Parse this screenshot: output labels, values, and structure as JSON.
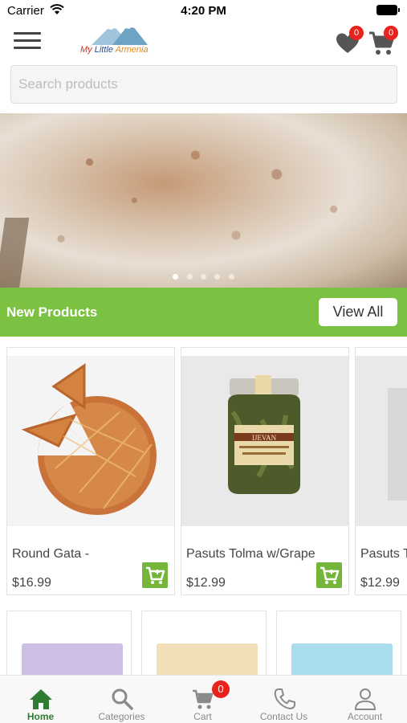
{
  "status_bar": {
    "carrier": "Carrier",
    "time": "4:20 PM"
  },
  "header": {
    "logo_words": [
      "My",
      "Little",
      "Armenia"
    ],
    "wishlist_count": "0",
    "cart_count": "0"
  },
  "search": {
    "placeholder": "Search products",
    "value": ""
  },
  "banner": {
    "slide_count": 5,
    "active_slide": 1
  },
  "new_products": {
    "title": "New Products",
    "view_all_label": "View All",
    "items": [
      {
        "name": "Round Gata -",
        "price": "$16.99"
      },
      {
        "name": "Pasuts Tolma w/Grape",
        "price": "$12.99"
      },
      {
        "name": "Pasuts T",
        "price": "$12.99"
      }
    ]
  },
  "jar_label": "IJEVAN",
  "tab_bar": {
    "items": [
      {
        "label": "Home",
        "icon": "home-icon",
        "active": true
      },
      {
        "label": "Categories",
        "icon": "search-icon",
        "active": false
      },
      {
        "label": "Cart",
        "icon": "cart-icon",
        "active": false,
        "badge": "0"
      },
      {
        "label": "Contact Us",
        "icon": "phone-icon",
        "active": false
      },
      {
        "label": "Account",
        "icon": "person-icon",
        "active": false
      }
    ]
  },
  "colors": {
    "accent_green": "#7bc242",
    "badge_red": "#e8221d",
    "active_tab": "#2e7d32"
  }
}
